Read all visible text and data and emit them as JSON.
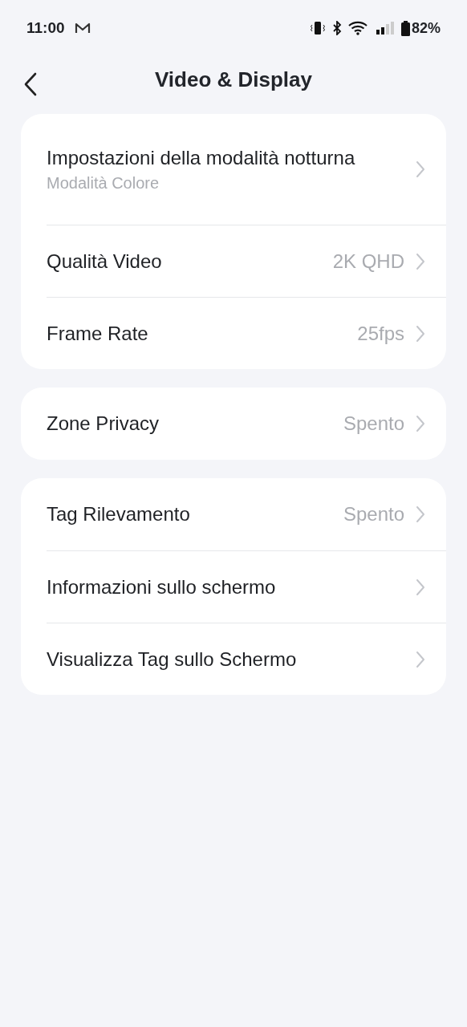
{
  "status_bar": {
    "time": "11:00",
    "battery": "82%"
  },
  "header": {
    "title": "Video & Display"
  },
  "groups": [
    {
      "rows": [
        {
          "label": "Impostazioni della modalità notturna",
          "subtitle": "Modalità Colore"
        },
        {
          "label": "Qualità Video",
          "value": "2K QHD"
        },
        {
          "label": "Frame Rate",
          "value": "25fps"
        }
      ]
    },
    {
      "rows": [
        {
          "label": "Zone Privacy",
          "value": "Spento"
        }
      ]
    },
    {
      "rows": [
        {
          "label": "Tag Rilevamento",
          "value": "Spento"
        },
        {
          "label": "Informazioni sullo schermo"
        },
        {
          "label": "Visualizza Tag sullo Schermo"
        }
      ]
    }
  ]
}
